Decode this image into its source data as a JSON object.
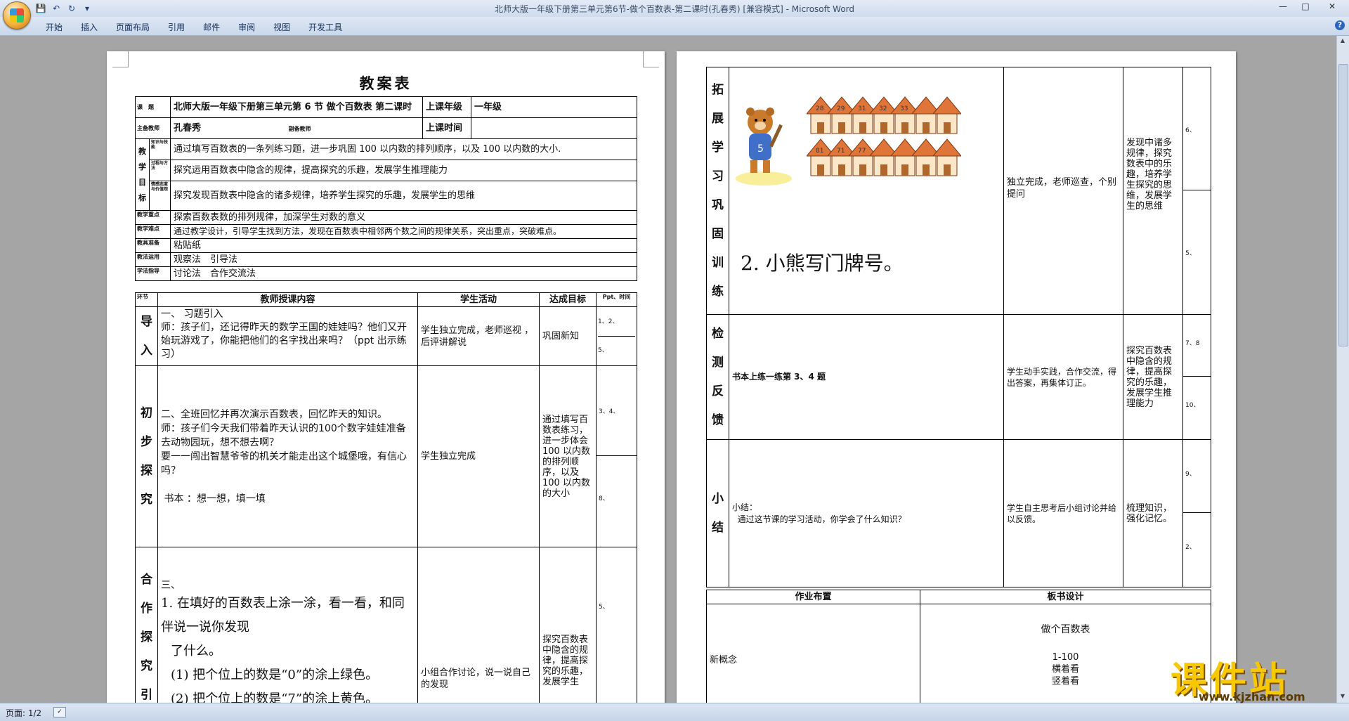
{
  "window": {
    "title": "北师大版一年级下册第三单元第6节-做个百数表-第二课时(孔春秀) [兼容模式] - Microsoft Word",
    "minimize": "—",
    "maximize": "□",
    "close": "✕"
  },
  "qat": {
    "save": "💾",
    "undo": "↶",
    "redo": "↻",
    "more": "▾"
  },
  "ribbon": {
    "tabs": [
      "开始",
      "插入",
      "页面布局",
      "引用",
      "邮件",
      "审阅",
      "视图",
      "开发工具"
    ],
    "help": "?"
  },
  "status": {
    "page": "页面: 1/2"
  },
  "page1": {
    "heading": "教案表",
    "course_label": "课　题",
    "course_value": "北师大版一年级下册第三单元第 6 节  做个百数表  第二课时",
    "class_time_label": "上课年级",
    "class_grade": "一年级",
    "teacher_label": "主备教师",
    "teacher_name": "孔春秀",
    "co_teacher_label": "副备教师",
    "lesson_time_label": "上课时间",
    "goals_label": [
      "教",
      "学",
      "目",
      "标"
    ],
    "goal_sub": [
      "知识与技能",
      "过程与方法",
      "情感态度与价值观"
    ],
    "goals": [
      "通过填写百数表的一条列练习题，进一步巩固 100 以内数的排列顺序，以及 100 以内数的大小.",
      "探究运用百数表中隐含的规律，提高探究的乐趣，发展学生推理能力",
      "探究发现百数表中隐含的诸多规律，培养学生探究的乐趣，发展学生的思维"
    ],
    "rows": [
      {
        "label": "教学重点",
        "value": "探索百数表数的排列规律，加深学生对数的意义"
      },
      {
        "label": "教学难点",
        "value": "通过教学设计，引导学生找到方法，发现在百数表中相邻两个数之间的规律关系，突出重点，突破难点。"
      },
      {
        "label": "教具准备",
        "value": "粘贴纸"
      },
      {
        "label": "教法运用",
        "value": "观察法　引导法"
      },
      {
        "label": "学法指导",
        "value": "讨论法　合作交流法"
      }
    ],
    "table_head": {
      "phase": "环节",
      "content": "教师授课内容",
      "student": "学生活动",
      "goal": "达成目标",
      "ppt": "Ppt、时间"
    },
    "sections": [
      {
        "phase": [
          "导",
          "入"
        ],
        "content": "一、 习题引入\n师：孩子们，还记得昨天的数学王国的娃娃吗？他们又开始玩游戏了，你能把他们的名字找出来吗？（ppt 出示练习）",
        "student": "学生独立完成，老师巡视 ，后评讲解说",
        "goal": "巩固新知",
        "ppt": [
          "1、2、",
          "5、"
        ]
      },
      {
        "phase": [
          "初",
          "步",
          "探",
          "究"
        ],
        "content": "二、全班回忆并再次演示百数表，回忆昨天的知识。\n师：孩子们今天我们带着昨天认识的100个数字娃娃准备去动物园玩，想不想去啊？\n要一一闯出智慧爷爷的机关才能走出这个城堡哦，有信心吗？\n\n 书本 ：想一想，填一填",
        "student": "学生独立完成",
        "goal": "通过填写百数表练习，进一步体会 100 以内数的排列顺序，以及 100 以内数的大小",
        "ppt": [
          "3、4、",
          "8、"
        ]
      },
      {
        "phase": [
          "合",
          "作",
          "探",
          "究",
          "引"
        ],
        "content_intro": "三、",
        "hw_lines": [
          "1. 在填好的百数表上涂一涂，看一看，和同伴说一说你发现",
          "了什么。",
          "(1) 把个位上的数是“0”的涂上绿色。",
          "(2) 把个位上的数是“7”的涂上黄色。"
        ],
        "student": "小组合作讨论，说一说自己的发现",
        "goal": "探究百数表中隐含的规律，提高探究的乐趣，发展学生",
        "ppt": [
          "5、"
        ]
      }
    ]
  },
  "page2": {
    "s1": {
      "phase": [
        "拓",
        "展",
        "学",
        "习",
        "巩",
        "固",
        "训",
        "练"
      ],
      "house_numbers_top": [
        "28",
        "29",
        "31",
        "32",
        "33"
      ],
      "house_numbers_bottom": [
        "81",
        "71",
        "77"
      ],
      "bear_sign": "5",
      "task": "2. 小熊写门牌号。",
      "student": "独立完成，老师巡查，个别提问",
      "goal": "发现中诸多规律，探究数表中的乐趣，培养学生探究的思维，发展学生的思维",
      "ppt": [
        "6、",
        "5、"
      ]
    },
    "s2": {
      "phase": [
        "检",
        "测",
        "反",
        "馈"
      ],
      "content": "书本上练一练第 3、4 题",
      "student": "学生动手实践，合作交流，得出答案，再集体订正。",
      "goal": "探究百数表中隐含的规律，提高探究的乐趣，发展学生推理能力",
      "ppt": [
        "7、8",
        "10、"
      ]
    },
    "s3": {
      "phase": [
        "小",
        "结"
      ],
      "content": "小结：\n  通过这节课的学习活动，你学会了什么知识？",
      "student": "学生自主思考后小组讨论并给以反馈。",
      "goal": "梳理知识，强化记忆。",
      "ppt": [
        "9、",
        "2、"
      ]
    },
    "homework_label": "作业布置",
    "board_label": "板书设计",
    "homework": "新概念",
    "board": [
      "做个百数表",
      "1-100",
      "横着看",
      "竖着看"
    ]
  },
  "watermark": {
    "text": "课件站",
    "url": "www.kjzhan.com"
  },
  "colors": {
    "accent": "#f6c800",
    "ribbon": "#cfdcec",
    "workspace": "#a5a5a5"
  }
}
